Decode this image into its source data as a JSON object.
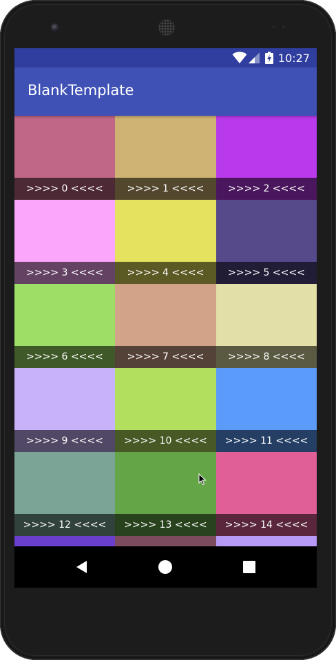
{
  "status_bar": {
    "time": "10:27",
    "icons": [
      "wifi-icon",
      "cell-signal-icon",
      "battery-charging-icon"
    ],
    "color": "#303F9F"
  },
  "app_bar": {
    "title": "BlankTemplate",
    "color": "#3F51B5"
  },
  "grid": {
    "items": [
      {
        "label": ">>>> 0 <<<<",
        "color": "#C06787"
      },
      {
        "label": ">>>> 1 <<<<",
        "color": "#CFB374"
      },
      {
        "label": ">>>> 2 <<<<",
        "color": "#B93AEA"
      },
      {
        "label": ">>>> 3 <<<<",
        "color": "#FBA6FB"
      },
      {
        "label": ">>>> 4 <<<<",
        "color": "#E4E25E"
      },
      {
        "label": ">>>> 5 <<<<",
        "color": "#564A8A"
      },
      {
        "label": ">>>> 6 <<<<",
        "color": "#9EDE67"
      },
      {
        "label": ">>>> 7 <<<<",
        "color": "#D3A389"
      },
      {
        "label": ">>>> 8 <<<<",
        "color": "#E2E0A8"
      },
      {
        "label": ">>>> 9 <<<<",
        "color": "#C8B3FB"
      },
      {
        "label": ">>>> 10 <<<<",
        "color": "#B2DF5E"
      },
      {
        "label": ">>>> 11 <<<<",
        "color": "#5B9BFA"
      },
      {
        "label": ">>>> 12 <<<<",
        "color": "#7BA497"
      },
      {
        "label": ">>>> 13 <<<<",
        "color": "#63A547"
      },
      {
        "label": ">>>> 14 <<<<",
        "color": "#E15F97"
      },
      {
        "label": "",
        "color": "#6B3FCE"
      },
      {
        "label": "",
        "color": "#7C4C5E"
      },
      {
        "label": "",
        "color": "#B79AF5"
      }
    ]
  },
  "nav_bar": {
    "buttons": [
      "back-icon",
      "home-icon",
      "recents-icon"
    ]
  }
}
